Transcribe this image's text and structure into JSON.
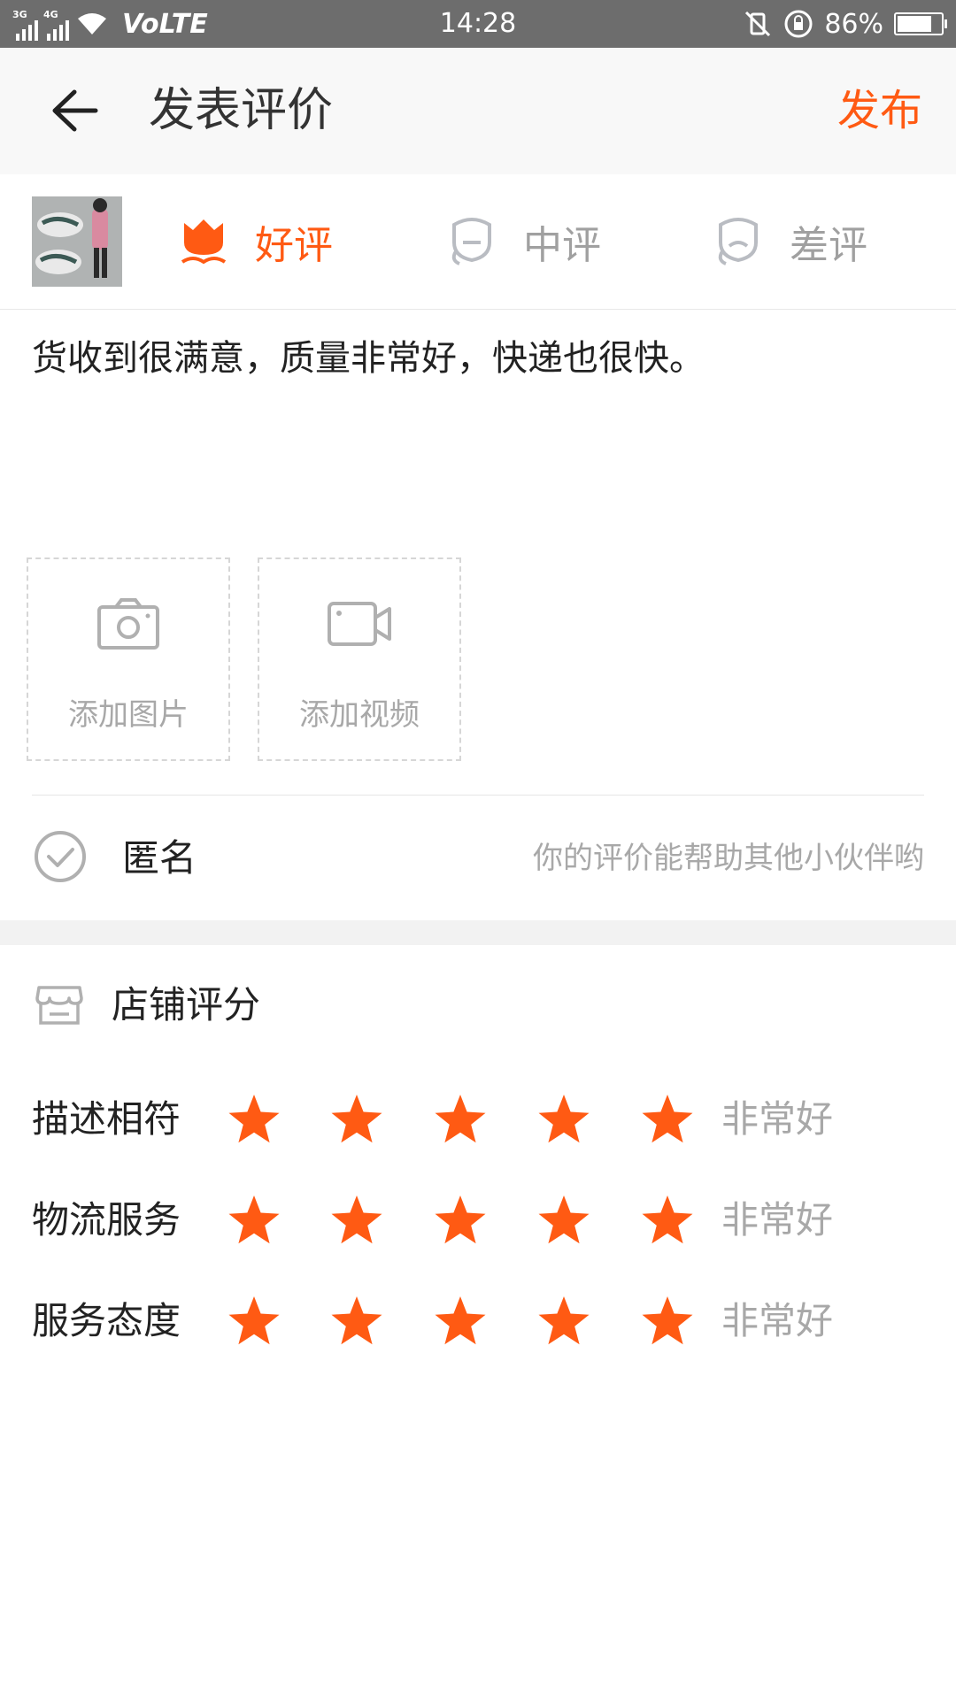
{
  "status_bar": {
    "net1": "3G",
    "net2": "4G",
    "volte": "VoLTE",
    "time": "14:28",
    "battery_text": "86%",
    "battery_level": 0.86
  },
  "header": {
    "title": "发表评价",
    "publish_label": "发布",
    "accent_color": "#ff5a13"
  },
  "rating_tabs": [
    {
      "label": "好评",
      "selected": true,
      "icon": "flower-icon"
    },
    {
      "label": "中评",
      "selected": false,
      "icon": "neutral-face-icon"
    },
    {
      "label": "差评",
      "selected": false,
      "icon": "bad-face-icon"
    }
  ],
  "review": {
    "text": "货收到很满意，质量非常好，快递也很快。"
  },
  "media": {
    "add_photo": "添加图片",
    "add_video": "添加视频"
  },
  "anonymous": {
    "label": "匿名",
    "hint": "你的评价能帮助其他小伙伴哟"
  },
  "shop_rating": {
    "title": "店铺评分",
    "items": [
      {
        "label": "描述相符",
        "stars": 5,
        "max": 5,
        "text": "非常好"
      },
      {
        "label": "物流服务",
        "stars": 5,
        "max": 5,
        "text": "非常好"
      },
      {
        "label": "服务态度",
        "stars": 5,
        "max": 5,
        "text": "非常好"
      }
    ]
  }
}
